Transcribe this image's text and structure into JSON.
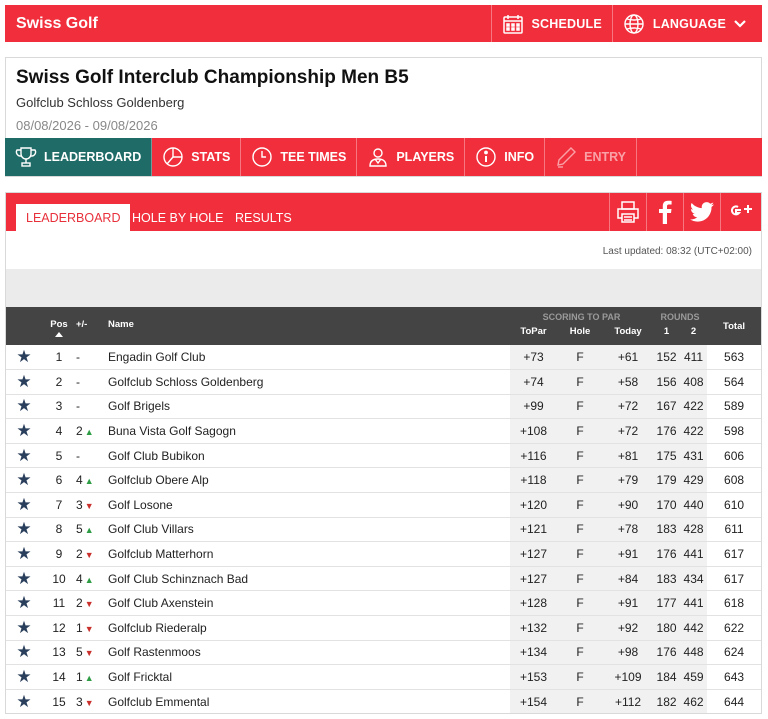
{
  "app": {
    "title": "Swiss Golf"
  },
  "topbar": {
    "schedule": "SCHEDULE",
    "language": "LANGUAGE"
  },
  "event": {
    "title": "Swiss Golf Interclub Championship Men B5",
    "venue": "Golfclub Schloss Goldenberg",
    "dates": "08/08/2026 - 09/08/2026"
  },
  "nav": {
    "leaderboard": "LEADERBOARD",
    "stats": "STATS",
    "tee_times": "TEE TIMES",
    "players": "PLAYERS",
    "info": "INFO",
    "entry": "ENTRY"
  },
  "subtabs": {
    "leaderboard": "LEADERBOARD",
    "hole_by_hole": "HOLE BY HOLE",
    "results": "RESULTS"
  },
  "last_updated": "Last updated: 08:32 (UTC+02:00)",
  "table": {
    "headers": {
      "pos": "Pos",
      "move": "+/-",
      "name": "Name",
      "scoring_group": "SCORING TO PAR",
      "rounds_group": "ROUNDS",
      "topar": "ToPar",
      "hole": "Hole",
      "today": "Today",
      "r1": "1",
      "r2": "2",
      "total": "Total"
    },
    "rows": [
      {
        "pos": "1",
        "move": "-",
        "dir": "",
        "name": "Engadin Golf Club",
        "topar": "+73",
        "hole": "F",
        "today": "+61",
        "r1": "152",
        "r2": "411",
        "total": "563"
      },
      {
        "pos": "2",
        "move": "-",
        "dir": "",
        "name": "Golfclub Schloss Goldenberg",
        "topar": "+74",
        "hole": "F",
        "today": "+58",
        "r1": "156",
        "r2": "408",
        "total": "564"
      },
      {
        "pos": "3",
        "move": "-",
        "dir": "",
        "name": "Golf Brigels",
        "topar": "+99",
        "hole": "F",
        "today": "+72",
        "r1": "167",
        "r2": "422",
        "total": "589"
      },
      {
        "pos": "4",
        "move": "2",
        "dir": "up",
        "name": "Buna Vista Golf Sagogn",
        "topar": "+108",
        "hole": "F",
        "today": "+72",
        "r1": "176",
        "r2": "422",
        "total": "598"
      },
      {
        "pos": "5",
        "move": "-",
        "dir": "",
        "name": "Golf Club Bubikon",
        "topar": "+116",
        "hole": "F",
        "today": "+81",
        "r1": "175",
        "r2": "431",
        "total": "606"
      },
      {
        "pos": "6",
        "move": "4",
        "dir": "up",
        "name": "Golfclub Obere Alp",
        "topar": "+118",
        "hole": "F",
        "today": "+79",
        "r1": "179",
        "r2": "429",
        "total": "608"
      },
      {
        "pos": "7",
        "move": "3",
        "dir": "down",
        "name": "Golf Losone",
        "topar": "+120",
        "hole": "F",
        "today": "+90",
        "r1": "170",
        "r2": "440",
        "total": "610"
      },
      {
        "pos": "8",
        "move": "5",
        "dir": "up",
        "name": "Golf Club Villars",
        "topar": "+121",
        "hole": "F",
        "today": "+78",
        "r1": "183",
        "r2": "428",
        "total": "611"
      },
      {
        "pos": "9",
        "move": "2",
        "dir": "down",
        "name": "Golfclub Matterhorn",
        "topar": "+127",
        "hole": "F",
        "today": "+91",
        "r1": "176",
        "r2": "441",
        "total": "617"
      },
      {
        "pos": "10",
        "move": "4",
        "dir": "up",
        "name": "Golf Club Schinznach Bad",
        "topar": "+127",
        "hole": "F",
        "today": "+84",
        "r1": "183",
        "r2": "434",
        "total": "617"
      },
      {
        "pos": "11",
        "move": "2",
        "dir": "down",
        "name": "Golf Club Axenstein",
        "topar": "+128",
        "hole": "F",
        "today": "+91",
        "r1": "177",
        "r2": "441",
        "total": "618"
      },
      {
        "pos": "12",
        "move": "1",
        "dir": "down",
        "name": "Golfclub Riederalp",
        "topar": "+132",
        "hole": "F",
        "today": "+92",
        "r1": "180",
        "r2": "442",
        "total": "622"
      },
      {
        "pos": "13",
        "move": "5",
        "dir": "down",
        "name": "Golf Rastenmoos",
        "topar": "+134",
        "hole": "F",
        "today": "+98",
        "r1": "176",
        "r2": "448",
        "total": "624"
      },
      {
        "pos": "14",
        "move": "1",
        "dir": "up",
        "name": "Golf Fricktal",
        "topar": "+153",
        "hole": "F",
        "today": "+109",
        "r1": "184",
        "r2": "459",
        "total": "643"
      },
      {
        "pos": "15",
        "move": "3",
        "dir": "down",
        "name": "Golfclub Emmental",
        "topar": "+154",
        "hole": "F",
        "today": "+112",
        "r1": "182",
        "r2": "462",
        "total": "644"
      }
    ]
  },
  "icons": {
    "schedule": "calendar-icon",
    "language": "globe-icon",
    "leaderboard": "trophy-icon",
    "stats": "pie-chart-icon",
    "tee_times": "clock-icon",
    "players": "person-icon",
    "info": "info-icon",
    "entry": "pen-icon",
    "print": "printer-icon",
    "facebook": "facebook-icon",
    "twitter": "twitter-icon",
    "google_plus": "google-plus-icon",
    "favorite": "star-icon"
  },
  "colors": {
    "brand_red": "#f12f3c",
    "active_teal": "#1f6b67",
    "header_dark": "#444444",
    "up": "#2e9c44",
    "down": "#c9302c",
    "star": "#2a3f5c"
  }
}
